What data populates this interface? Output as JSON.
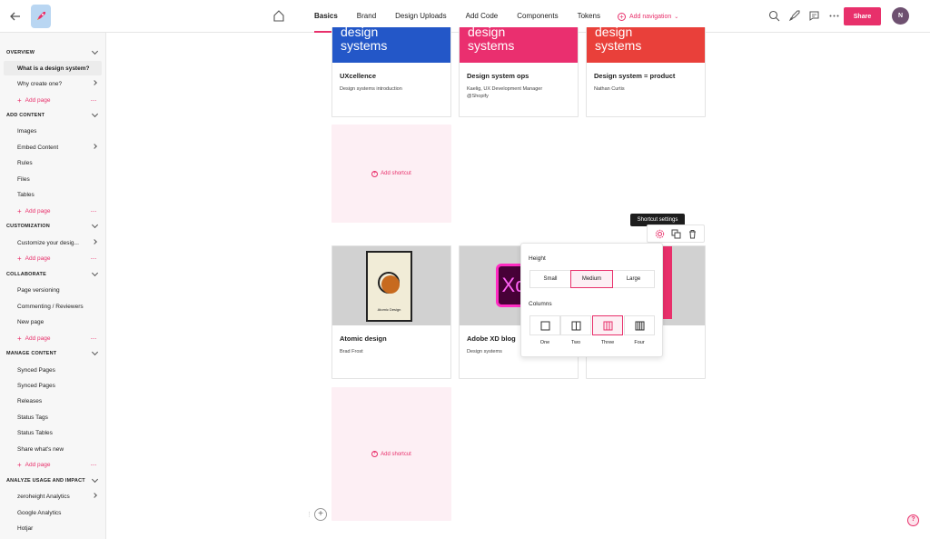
{
  "topbar": {
    "tabs": [
      "Basics",
      "Brand",
      "Design Uploads",
      "Add Code",
      "Components",
      "Tokens"
    ],
    "add_navigation": "Add navigation",
    "share": "Share",
    "avatar_initial": "N",
    "accent": "#e8306b"
  },
  "sidebar": {
    "s_overview": "OVERVIEW",
    "i_design_system": "What is a design system?",
    "i_why_create": "Why create one?",
    "add_page": "Add page",
    "s_add_content": "ADD CONTENT",
    "i_images": "Images",
    "i_embed": "Embed Content",
    "i_rules": "Rules",
    "i_files": "Files",
    "i_tables": "Tables",
    "s_customization": "CUSTOMIZATION",
    "i_customize": "Customize your desig...",
    "s_collaborate": "COLLABORATE",
    "i_versioning": "Page versioning",
    "i_commenting": "Commenting / Reviewers",
    "i_new_page": "New page",
    "s_manage": "MANAGE CONTENT",
    "i_synced1": "Synced Pages",
    "i_synced2": "Synced Pages",
    "i_releases": "Releases",
    "i_status_tags": "Status Tags",
    "i_status_tables": "Status Tables",
    "i_share_new": "Share what's new",
    "s_analyze": "ANALYZE USAGE AND IMPACT",
    "i_zh_analytics": "zeroheight Analytics",
    "i_google": "Google Analytics",
    "i_hotjar": "Hotjar"
  },
  "cards": {
    "c1": {
      "banner": "design\nsystems",
      "title": "UXcellence",
      "sub": "Design systems introduction",
      "color": "#2357c8"
    },
    "c2": {
      "banner": "design\nsystems",
      "title": "Design system ops",
      "sub": "Kaelig, UX Development Manager @Shopify",
      "color": "#ea2f6f"
    },
    "c3": {
      "banner": "design\nsystems",
      "title": "Design system = product",
      "sub": "Nathan Curtis",
      "color": "#e9403a"
    },
    "c4": {
      "title": "Atomic design",
      "sub": "Brad Frost",
      "poster_text": "Atomic Design"
    },
    "c5": {
      "title": "Adobe XD blog",
      "sub": "Design systems",
      "logo_text": "Xd"
    },
    "add_shortcut": "Add shortcut"
  },
  "popover": {
    "tooltip": "Shortcut settings",
    "height_label": "Height",
    "heights": [
      "Small",
      "Medium",
      "Large"
    ],
    "height_selected": "Medium",
    "columns_label": "Columns",
    "columns": [
      "One",
      "Two",
      "Three",
      "Four"
    ],
    "columns_selected": "Three"
  }
}
